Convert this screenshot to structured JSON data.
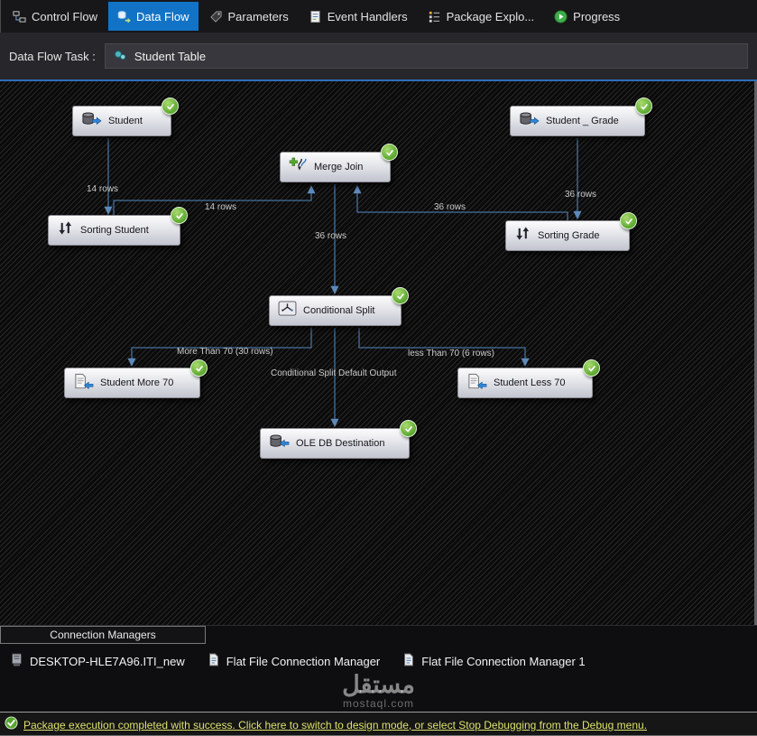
{
  "tabs": [
    {
      "label": "Control Flow",
      "icon": "control-flow-icon",
      "active": false
    },
    {
      "label": "Data Flow",
      "icon": "data-flow-icon",
      "active": true
    },
    {
      "label": "Parameters",
      "icon": "parameters-icon",
      "active": false
    },
    {
      "label": "Event Handlers",
      "icon": "event-handlers-icon",
      "active": false
    },
    {
      "label": "Package Explo...",
      "icon": "package-explorer-icon",
      "active": false
    },
    {
      "label": "Progress",
      "icon": "progress-icon",
      "active": false
    }
  ],
  "task_bar": {
    "label": "Data Flow Task :",
    "value": "Student Table"
  },
  "canvas": {
    "nodes": [
      {
        "label": "Student",
        "type": "ole-db-source",
        "status": "success"
      },
      {
        "label": "Student _ Grade",
        "type": "ole-db-source",
        "status": "success"
      },
      {
        "label": "Merge Join",
        "type": "merge-join",
        "status": "success"
      },
      {
        "label": "Sorting Student",
        "type": "sort",
        "status": "success"
      },
      {
        "label": "Sorting Grade",
        "type": "sort",
        "status": "success"
      },
      {
        "label": "Conditional Split",
        "type": "conditional-split",
        "status": "success"
      },
      {
        "label": "Student More 70",
        "type": "flat-file-destination",
        "status": "success"
      },
      {
        "label": "Student Less 70",
        "type": "flat-file-destination",
        "status": "success"
      },
      {
        "label": "OLE DB Destination",
        "type": "ole-db-destination",
        "status": "success"
      }
    ],
    "edge_labels": [
      "14 rows",
      "14 rows",
      "36 rows",
      "36 rows",
      "36 rows",
      "More Than 70 (30 rows)",
      "Conditional Split Default Output",
      "less Than 70 (6 rows)"
    ]
  },
  "connection_managers": {
    "title": "Connection Managers",
    "items": [
      "DESKTOP-HLE7A96.ITI_new",
      "Flat File Connection Manager",
      "Flat File Connection Manager 1"
    ]
  },
  "watermark": {
    "title": "مستقل",
    "domain": "mostaql.com"
  },
  "status_bar": {
    "message": "Package execution completed with success. Click here to switch to design mode, or select Stop Debugging from the Debug menu."
  },
  "colors": {
    "accent_blue": "#1273c6",
    "success_green": "#57a52e",
    "edge_blue": "#46719f",
    "link_yellow": "#dde26b"
  }
}
